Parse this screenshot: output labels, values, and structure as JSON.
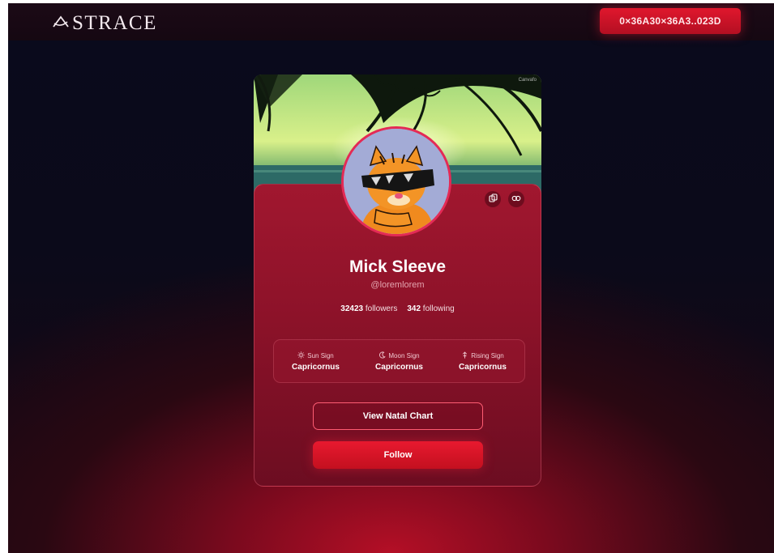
{
  "header": {
    "logo_text": "STRACE",
    "wallet_address": "0×36A30×36A3..023D"
  },
  "profile": {
    "banner_watermark": "Canvafo",
    "name": "Mick Sleeve",
    "handle": "@loremlorem",
    "followers_count": "32423",
    "followers_label": "followers",
    "following_count": "342",
    "following_label": "following"
  },
  "signs": [
    {
      "icon": "sun-icon",
      "label": "Sun Sign",
      "value": "Capricornus"
    },
    {
      "icon": "moon-icon",
      "label": "Moon Sign",
      "value": "Capricornus"
    },
    {
      "icon": "rising-icon",
      "label": "Rising Sign",
      "value": "Capricornus"
    }
  ],
  "actions": {
    "natal_chart_label": "View Natal Chart",
    "follow_label": "Follow"
  },
  "colors": {
    "accent": "#e0172d",
    "panel": "#9a162d",
    "background_dark": "#0b0a1a"
  }
}
